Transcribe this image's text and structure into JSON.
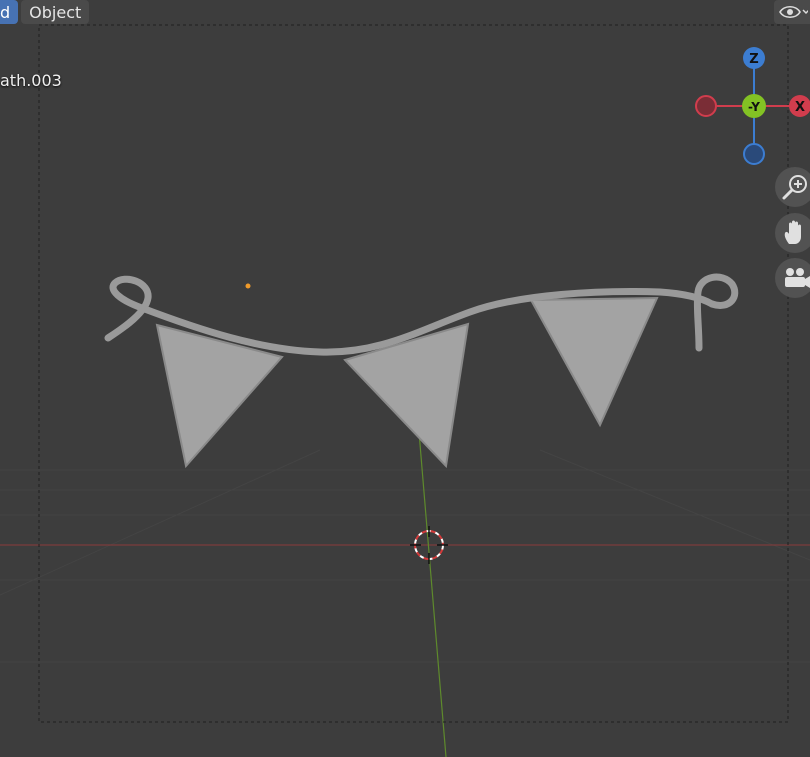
{
  "header": {
    "mode_label": "d",
    "object_menu_label": "Object"
  },
  "viewport": {
    "object_name": "ath.003",
    "gizmo": {
      "z_label": "Z",
      "y_label": "-Y",
      "x_label": "X",
      "colors": {
        "x": "#d13d4d",
        "y": "#83c224",
        "z": "#3c7dd1"
      }
    },
    "nav_icons": [
      "zoom-icon",
      "pan-hand-icon",
      "camera-icon"
    ]
  }
}
